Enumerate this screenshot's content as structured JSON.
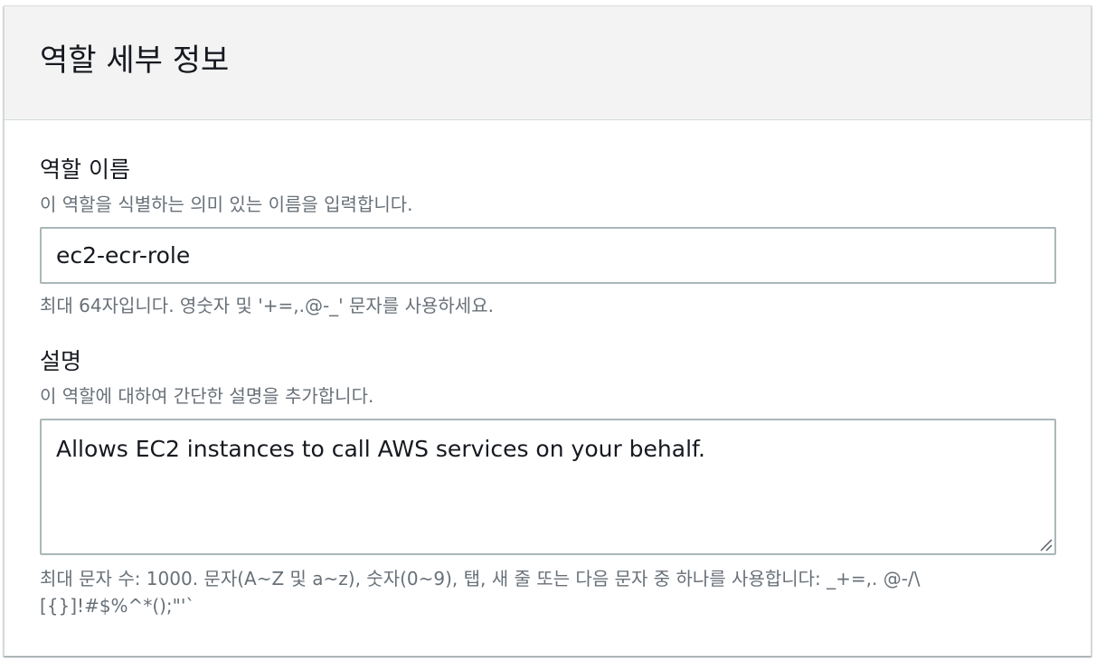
{
  "section": {
    "title": "역할 세부 정보"
  },
  "role_name": {
    "label": "역할 이름",
    "description": "이 역할을 식별하는 의미 있는 이름을 입력합니다.",
    "value": "ec2-ecr-role",
    "constraint": "최대 64자입니다. 영숫자 및 '+=,.@-_' 문자를 사용하세요."
  },
  "description_field": {
    "label": "설명",
    "description": "이 역할에 대하여 간단한 설명을 추가합니다.",
    "value": "Allows EC2 instances to call AWS services on your behalf.",
    "constraint_line1": "최대 문자 수: 1000. 문자(A~Z 및 a~z), 숫자(0~9), 탭, 새 줄 또는 다음 문자 중 하나를 사용합니다: _+=,. @-/\\",
    "constraint_line2": "[{}]!#$%^*();\"'`"
  },
  "colors": {
    "header_bg": "#f3f3f3",
    "border": "#d5dbdb",
    "input_border": "#aab7b8",
    "secondary_text": "#687078",
    "primary_text": "#16191f"
  },
  "icons": {
    "resize": "resize-handle-icon"
  }
}
